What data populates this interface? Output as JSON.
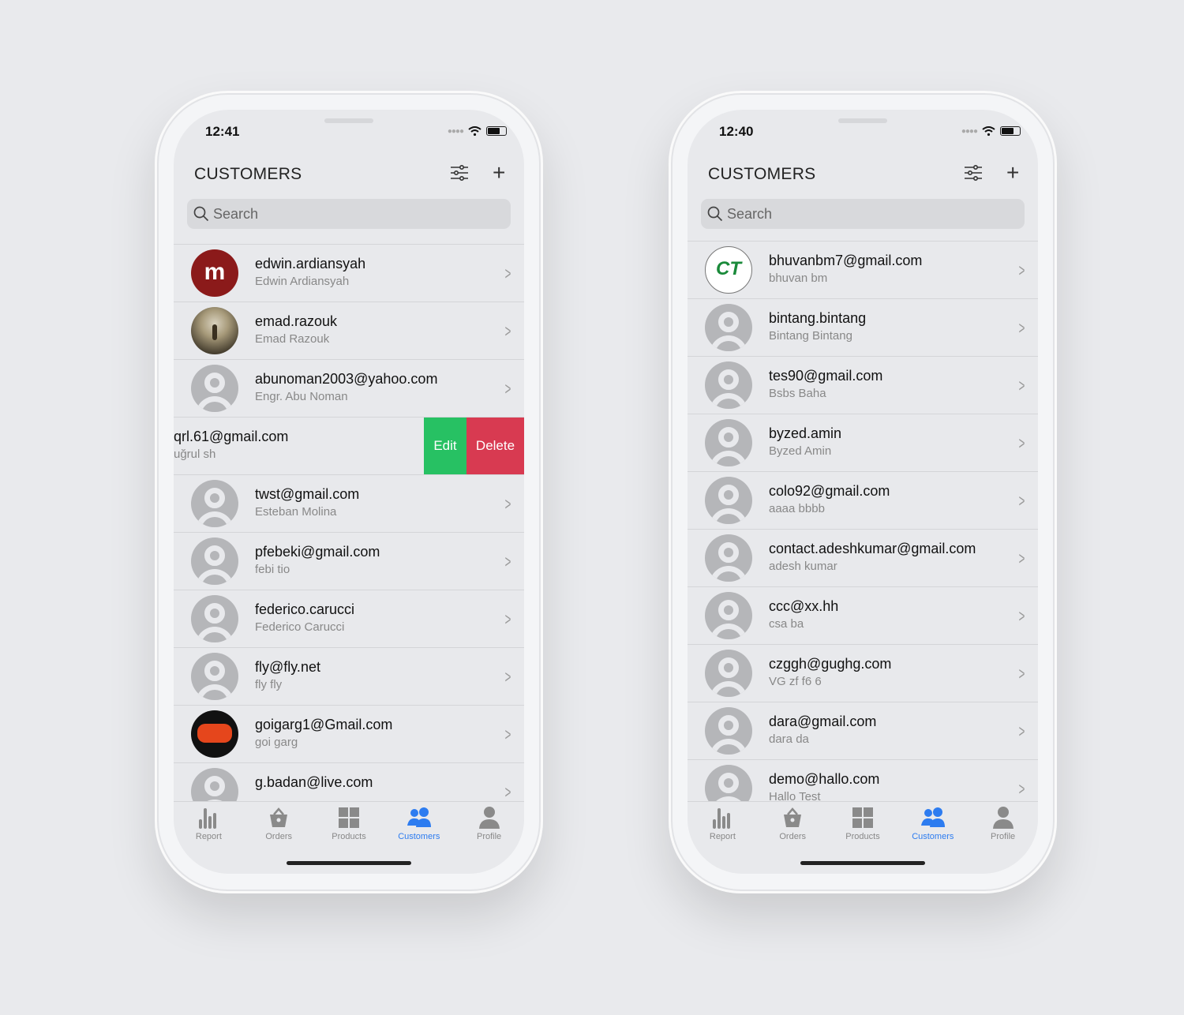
{
  "colors": {
    "accent": "#2d7cf0",
    "edit": "#27c163",
    "delete": "#d83a51"
  },
  "phones": [
    {
      "time": "12:41",
      "title": "CUSTOMERS",
      "search_placeholder": "Search",
      "rows": [
        {
          "email": "edwin.ardiansyah",
          "name": "Edwin Ardiansyah",
          "avatar": "logo-m",
          "avatar_text": "m"
        },
        {
          "email": "emad.razouk",
          "name": "Emad Razouk",
          "avatar": "photo"
        },
        {
          "email": "abunoman2003@yahoo.com",
          "name": "Engr. Abu Noman",
          "avatar": "default"
        },
        {
          "email": "qrl.61@gmail.com",
          "name": "uğrul sh",
          "avatar": "default",
          "swiped": true,
          "edit_label": "Edit",
          "delete_label": "Delete"
        },
        {
          "email": "twst@gmail.com",
          "name": "Esteban Molina",
          "avatar": "default"
        },
        {
          "email": "pfebeki@gmail.com",
          "name": "febi tio",
          "avatar": "default"
        },
        {
          "email": "federico.carucci",
          "name": "Federico Carucci",
          "avatar": "default"
        },
        {
          "email": "fly@fly.net",
          "name": "fly fly",
          "avatar": "default"
        },
        {
          "email": "goigarg1@Gmail.com",
          "name": "goi garg",
          "avatar": "game"
        },
        {
          "email": "g.badan@live.com",
          "name": "",
          "avatar": "default"
        }
      ],
      "tabs": [
        {
          "label": "Report",
          "icon": "bar-chart"
        },
        {
          "label": "Orders",
          "icon": "basket"
        },
        {
          "label": "Products",
          "icon": "grid"
        },
        {
          "label": "Customers",
          "icon": "people",
          "active": true
        },
        {
          "label": "Profile",
          "icon": "person"
        }
      ]
    },
    {
      "time": "12:40",
      "title": "CUSTOMERS",
      "search_placeholder": "Search",
      "rows": [
        {
          "email": "bhuvanbm7@gmail.com",
          "name": "bhuvan bm",
          "avatar": "ct",
          "avatar_text": "CT"
        },
        {
          "email": "bintang.bintang",
          "name": "Bintang Bintang",
          "avatar": "default"
        },
        {
          "email": "tes90@gmail.com",
          "name": "Bsbs Baha",
          "avatar": "default"
        },
        {
          "email": "byzed.amin",
          "name": "Byzed Amin",
          "avatar": "default"
        },
        {
          "email": "colo92@gmail.com",
          "name": "aaaa bbbb",
          "avatar": "default"
        },
        {
          "email": "contact.adeshkumar@gmail.com",
          "name": "adesh kumar",
          "avatar": "default"
        },
        {
          "email": "ccc@xx.hh",
          "name": "csa ba",
          "avatar": "default"
        },
        {
          "email": "czggh@gughg.com",
          "name": "VG zf f6 6",
          "avatar": "default"
        },
        {
          "email": "dara@gmail.com",
          "name": "dara da",
          "avatar": "default"
        },
        {
          "email": "demo@hallo.com",
          "name": "Hallo Test",
          "avatar": "default"
        }
      ],
      "tabs": [
        {
          "label": "Report",
          "icon": "bar-chart"
        },
        {
          "label": "Orders",
          "icon": "basket"
        },
        {
          "label": "Products",
          "icon": "grid"
        },
        {
          "label": "Customers",
          "icon": "people",
          "active": true
        },
        {
          "label": "Profile",
          "icon": "person"
        }
      ]
    }
  ]
}
